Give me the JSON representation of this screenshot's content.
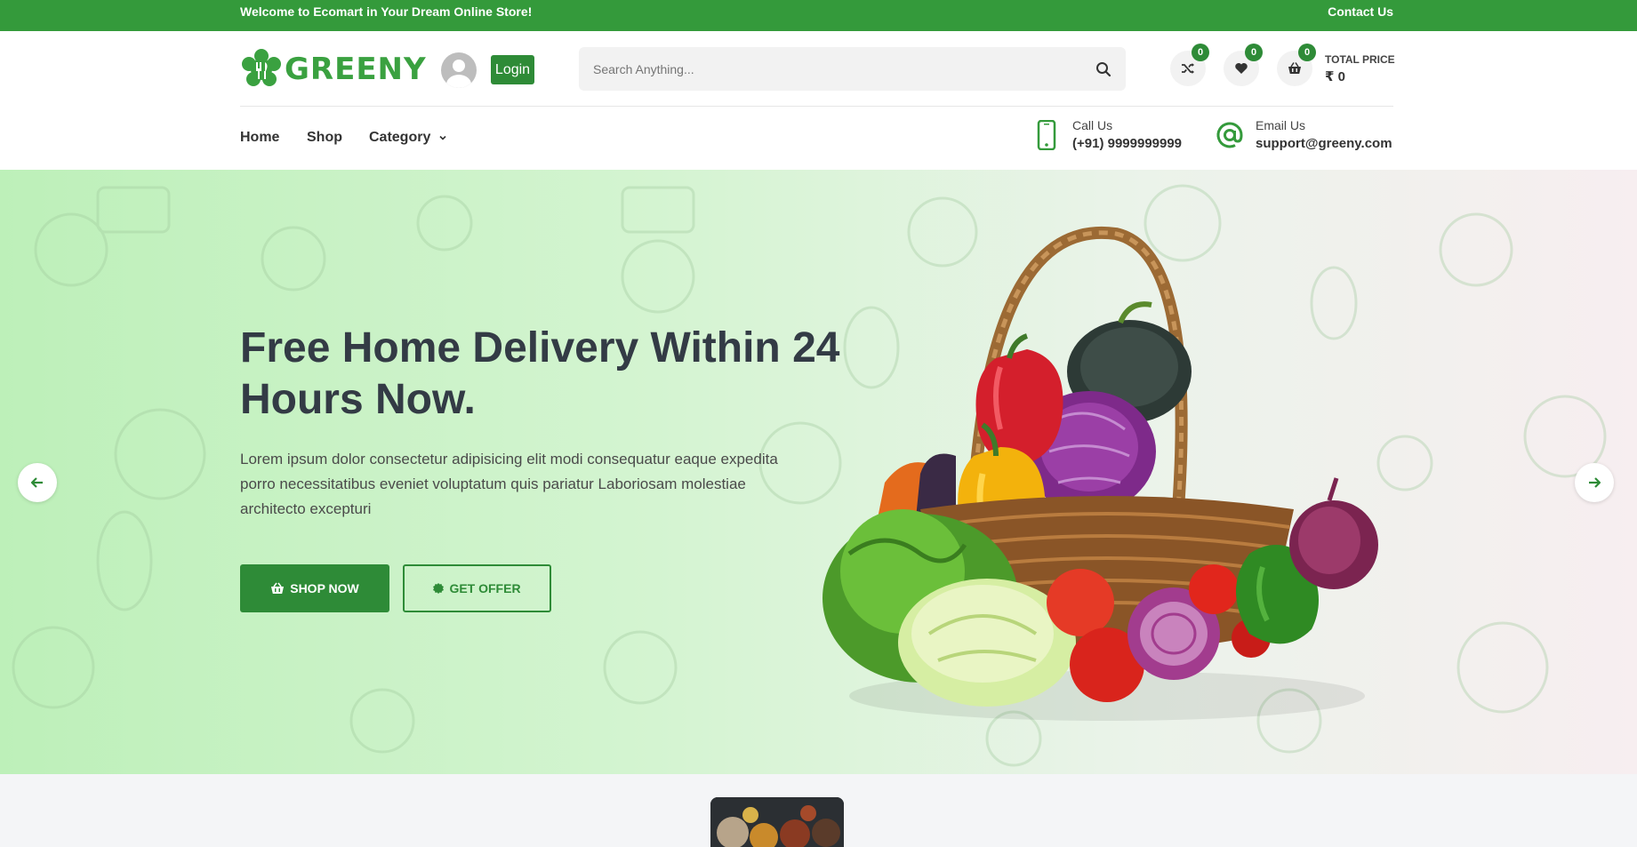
{
  "topbar": {
    "welcome": "Welcome to Ecomart in Your Dream Online Store!",
    "contact": "Contact Us"
  },
  "header": {
    "logo_text": "GREENY",
    "login_label": "Login",
    "search_placeholder": "Search Anything...",
    "compare_count": "0",
    "wishlist_count": "0",
    "cart_count": "0",
    "total_price_label": "TOTAL PRICE",
    "total_price_value": "₹ 0"
  },
  "nav": {
    "home": "Home",
    "shop": "Shop",
    "category": "Category",
    "call_label": "Call Us",
    "call_value": "(+91) 9999999999",
    "email_label": "Email Us",
    "email_value": "support@greeny.com"
  },
  "hero": {
    "title": "Free Home Delivery Within 24 Hours Now.",
    "description": "Lorem ipsum dolor consectetur adipisicing elit modi consequatur eaque expedita porro necessitatibus eveniet voluptatum quis pariatur Laboriosam molestiae architecto excepturi",
    "shop_now": "SHOP NOW",
    "get_offer": "GET OFFER"
  },
  "colors": {
    "brand": "#349a3b",
    "button": "#2e8b37",
    "heading": "#333b45"
  }
}
